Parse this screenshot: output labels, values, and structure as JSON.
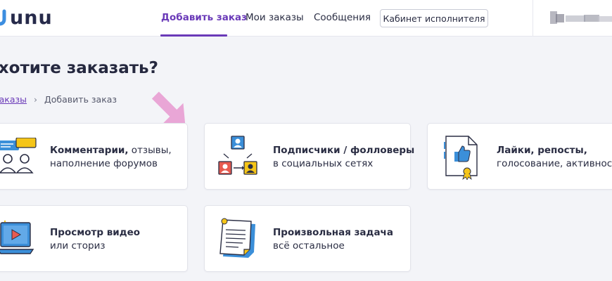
{
  "brand": {
    "logo_text": "UNU"
  },
  "nav": {
    "items": [
      {
        "label": "Добавить заказ",
        "active": true
      },
      {
        "label": "Мои заказы",
        "active": false
      },
      {
        "label": "Сообщения",
        "active": false
      }
    ],
    "cabinet_button": "Кабинет исполнителя"
  },
  "page": {
    "title": "о хотите заказать?",
    "breadcrumb": {
      "link": "заказы",
      "current": "Добавить заказ"
    }
  },
  "cards": [
    {
      "title": "Комментарии,",
      "title_rest": " отзывы,",
      "subtitle": "наполнение форумов",
      "icon": "comments-icon"
    },
    {
      "title": "Подписчики / фолловеры",
      "title_rest": "",
      "subtitle": "в социальных сетях",
      "icon": "followers-icon"
    },
    {
      "title": "Лайки, репосты,",
      "title_rest": "",
      "subtitle": "голосование, активность",
      "icon": "likes-icon"
    },
    {
      "title": "Просмотр видео",
      "title_rest": "",
      "subtitle": "или сториз",
      "icon": "video-icon"
    },
    {
      "title": "Произвольная задача",
      "title_rest": "",
      "subtitle": "всё остальное",
      "icon": "custom-task-icon"
    }
  ],
  "colors": {
    "accent": "#6a3ab8",
    "annotation_arrow": "#e9a6d6",
    "icon_blue": "#3b8fd9",
    "icon_yellow": "#f5c518"
  }
}
